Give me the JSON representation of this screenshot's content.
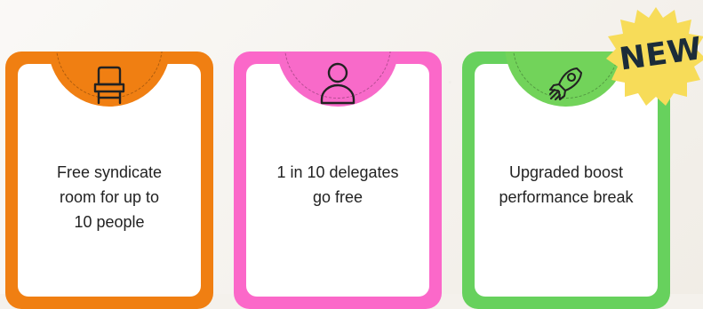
{
  "cards": [
    {
      "icon": "chair-icon",
      "lines": [
        "Free syndicate",
        "room for up to",
        "10 people"
      ],
      "accent": "#f07f12"
    },
    {
      "icon": "person-icon",
      "lines": [
        "1 in 10 delegates",
        "go free"
      ],
      "accent": "#fb68c9"
    },
    {
      "icon": "rocket-icon",
      "lines": [
        "Upgraded boost",
        "performance break"
      ],
      "accent": "#67d15d"
    }
  ],
  "badge": {
    "label": "NEW",
    "color": "#f7dc59",
    "text_color": "#1b2c39"
  },
  "background": "#f4f1ec"
}
